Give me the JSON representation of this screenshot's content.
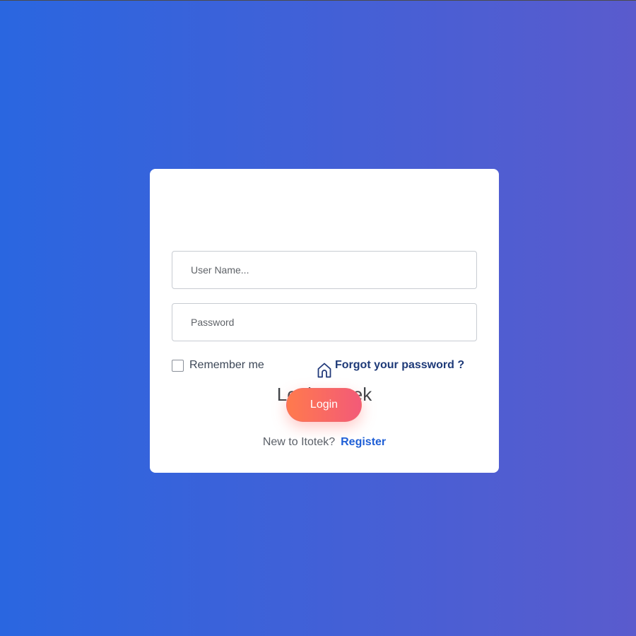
{
  "login_card": {
    "icon": "home-icon",
    "title": "Login Itotek",
    "username_placeholder": "User Name...",
    "password_placeholder": "Password",
    "remember_label": "Remember me",
    "forgot_link": "Forgot your password ?",
    "login_button": "Login",
    "register_prompt": "New to Itotek?",
    "register_link": "Register"
  },
  "colors": {
    "background_start": "#2a66e0",
    "background_end": "#5a5bcd",
    "title_text": "#404549",
    "link_dark": "#1e3a78",
    "link_blue": "#1f5fd6",
    "button_start": "#ff7a4d",
    "button_end": "#f35a78"
  }
}
